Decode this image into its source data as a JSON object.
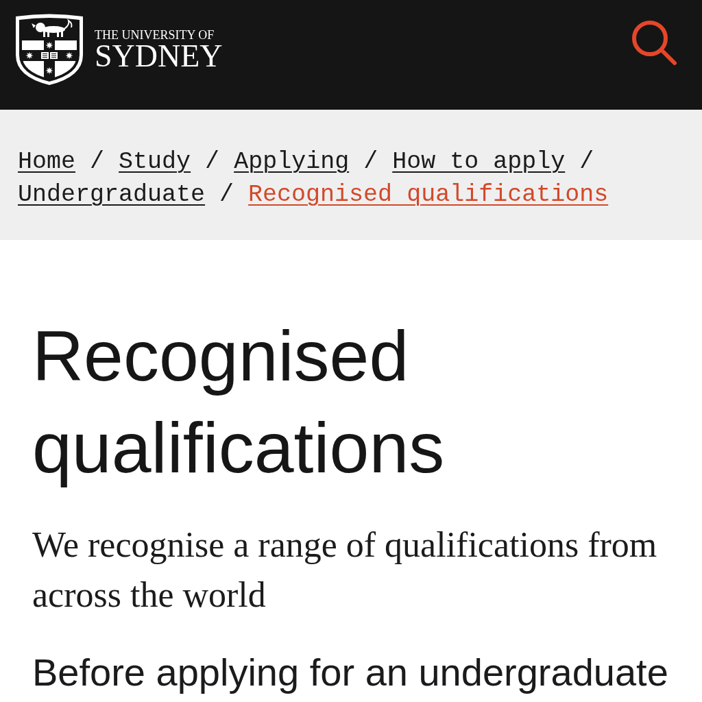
{
  "header": {
    "logo": {
      "line_1": "THE UNIVERSITY OF",
      "line_2": "SYDNEY"
    }
  },
  "breadcrumbs": {
    "separator": "/",
    "items": [
      {
        "label": "Home",
        "current": false
      },
      {
        "label": "Study",
        "current": false
      },
      {
        "label": "Applying",
        "current": false
      },
      {
        "label": "How to apply",
        "current": false
      },
      {
        "label": "Undergraduate",
        "current": false
      },
      {
        "label": "Recognised qualifications",
        "current": true
      }
    ]
  },
  "page": {
    "title": "Recognised qualifications",
    "intro": "We recognise a range of qualifications from across the world",
    "body": "Before applying for an undergraduate"
  }
}
